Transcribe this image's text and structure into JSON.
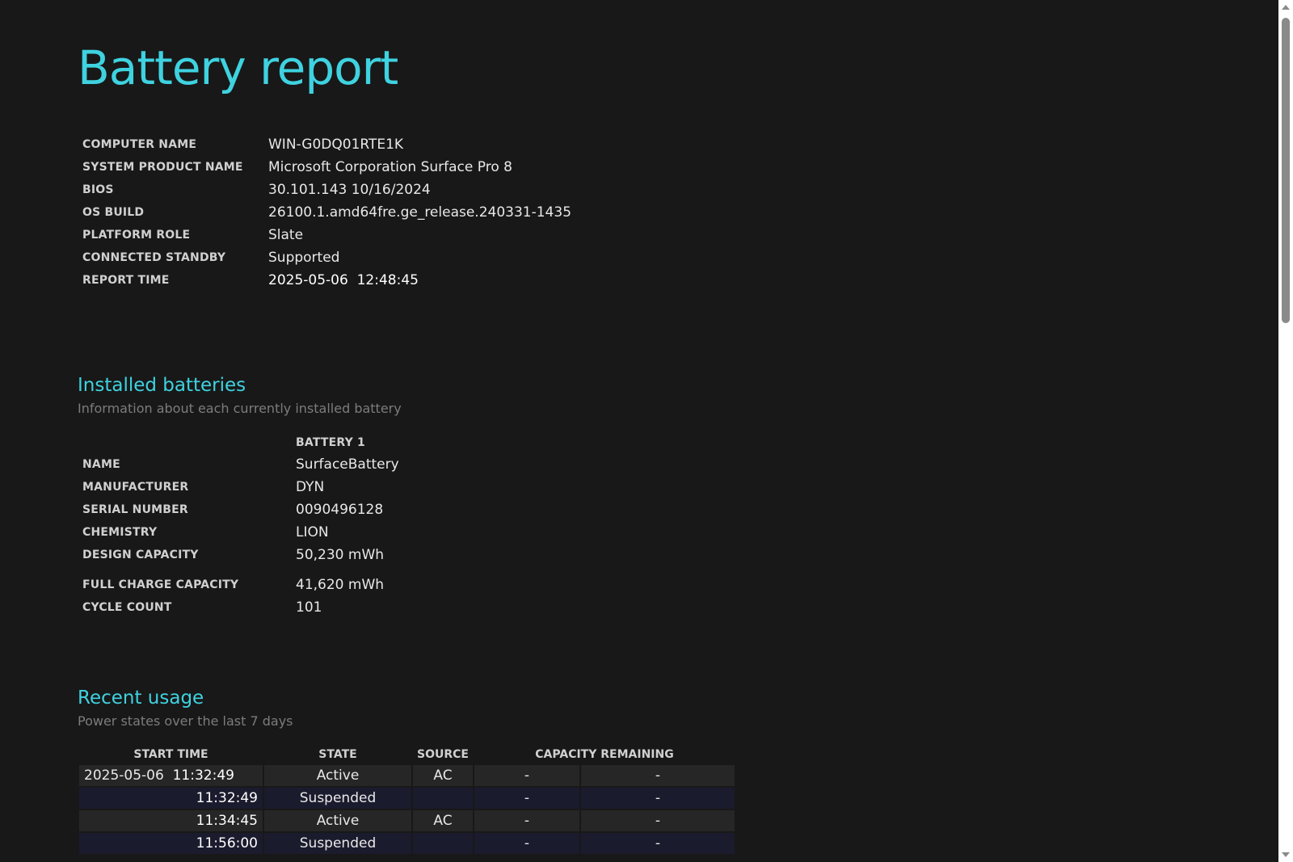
{
  "report": {
    "title": "Battery report",
    "info": [
      {
        "label": "COMPUTER NAME",
        "value": "WIN-G0DQ01RTE1K"
      },
      {
        "label": "SYSTEM PRODUCT NAME",
        "value": "Microsoft Corporation Surface Pro 8"
      },
      {
        "label": "BIOS",
        "value": "30.101.143 10/16/2024"
      },
      {
        "label": "OS BUILD",
        "value": "26100.1.amd64fre.ge_release.240331-1435"
      },
      {
        "label": "PLATFORM ROLE",
        "value": "Slate"
      },
      {
        "label": "CONNECTED STANDBY",
        "value": "Supported"
      },
      {
        "label": "REPORT TIME",
        "value": "2025-05-06  12:48:45"
      }
    ]
  },
  "installed_batteries": {
    "title": "Installed batteries",
    "subtitle": "Information about each currently installed battery",
    "column_header": "BATTERY 1",
    "rows": [
      {
        "label": "NAME",
        "value": "SurfaceBattery"
      },
      {
        "label": "MANUFACTURER",
        "value": "DYN"
      },
      {
        "label": "SERIAL NUMBER",
        "value": "0090496128"
      },
      {
        "label": "CHEMISTRY",
        "value": "LION"
      },
      {
        "label": "DESIGN CAPACITY",
        "value": "50,230 mWh"
      },
      {
        "label": "FULL CHARGE CAPACITY",
        "value": "41,620 mWh"
      },
      {
        "label": "CYCLE COUNT",
        "value": "101"
      }
    ]
  },
  "recent_usage": {
    "title": "Recent usage",
    "subtitle": "Power states over the last 7 days",
    "headers": {
      "start_time": "START TIME",
      "state": "STATE",
      "source": "SOURCE",
      "capacity_remaining": "CAPACITY REMAINING"
    },
    "rows": [
      {
        "date": "2025-05-06",
        "time": "11:32:49",
        "state": "Active",
        "source": "AC",
        "pct": "-",
        "mwh": "-"
      },
      {
        "date": "",
        "time": "11:32:49",
        "state": "Suspended",
        "source": "",
        "pct": "-",
        "mwh": "-"
      },
      {
        "date": "",
        "time": "11:34:45",
        "state": "Active",
        "source": "AC",
        "pct": "-",
        "mwh": "-"
      },
      {
        "date": "",
        "time": "11:56:00",
        "state": "Suspended",
        "source": "",
        "pct": "-",
        "mwh": "-"
      }
    ]
  },
  "colors": {
    "background": "#181818",
    "accent": "#3fd2e0",
    "row_odd": "#262626",
    "row_even": "#1b1b2e"
  }
}
